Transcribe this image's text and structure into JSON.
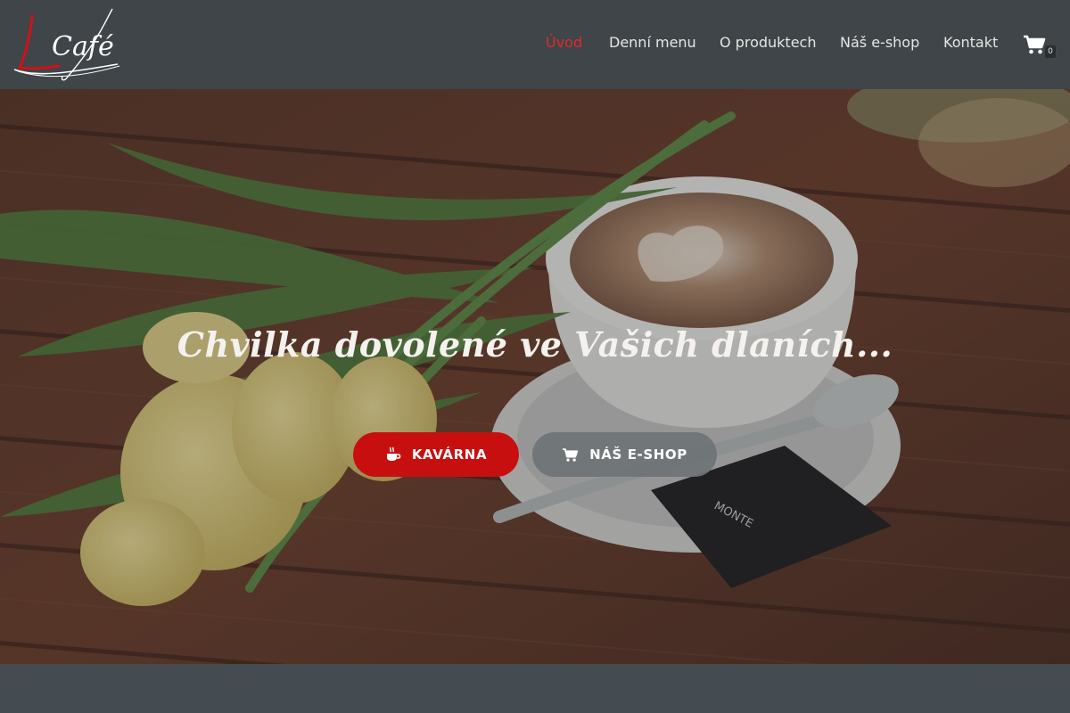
{
  "brand": {
    "logo_letter": "L",
    "logo_word": "Café"
  },
  "nav": {
    "items": [
      {
        "label": "Úvod",
        "active": true
      },
      {
        "label": "Denní menu",
        "active": false
      },
      {
        "label": "O produktech",
        "active": false
      },
      {
        "label": "Náš e-shop",
        "active": false
      },
      {
        "label": "Kontakt",
        "active": false
      }
    ],
    "cart_icon": "shopping-cart-icon",
    "cart_count": "0"
  },
  "hero": {
    "headline": "Chvilka dovolené ve Vašich dlaních...",
    "buttons": [
      {
        "label": "KAVÁRNA",
        "icon": "coffee-cup-icon"
      },
      {
        "label": "NÁŠ E-SHOP",
        "icon": "shopping-cart-icon"
      }
    ],
    "packet_text": "MONTE"
  },
  "colors": {
    "header_bg": "#3f4548",
    "accent": "#c80f10",
    "active_nav": "#e32a2a",
    "secondary_button": "#6e7376"
  }
}
